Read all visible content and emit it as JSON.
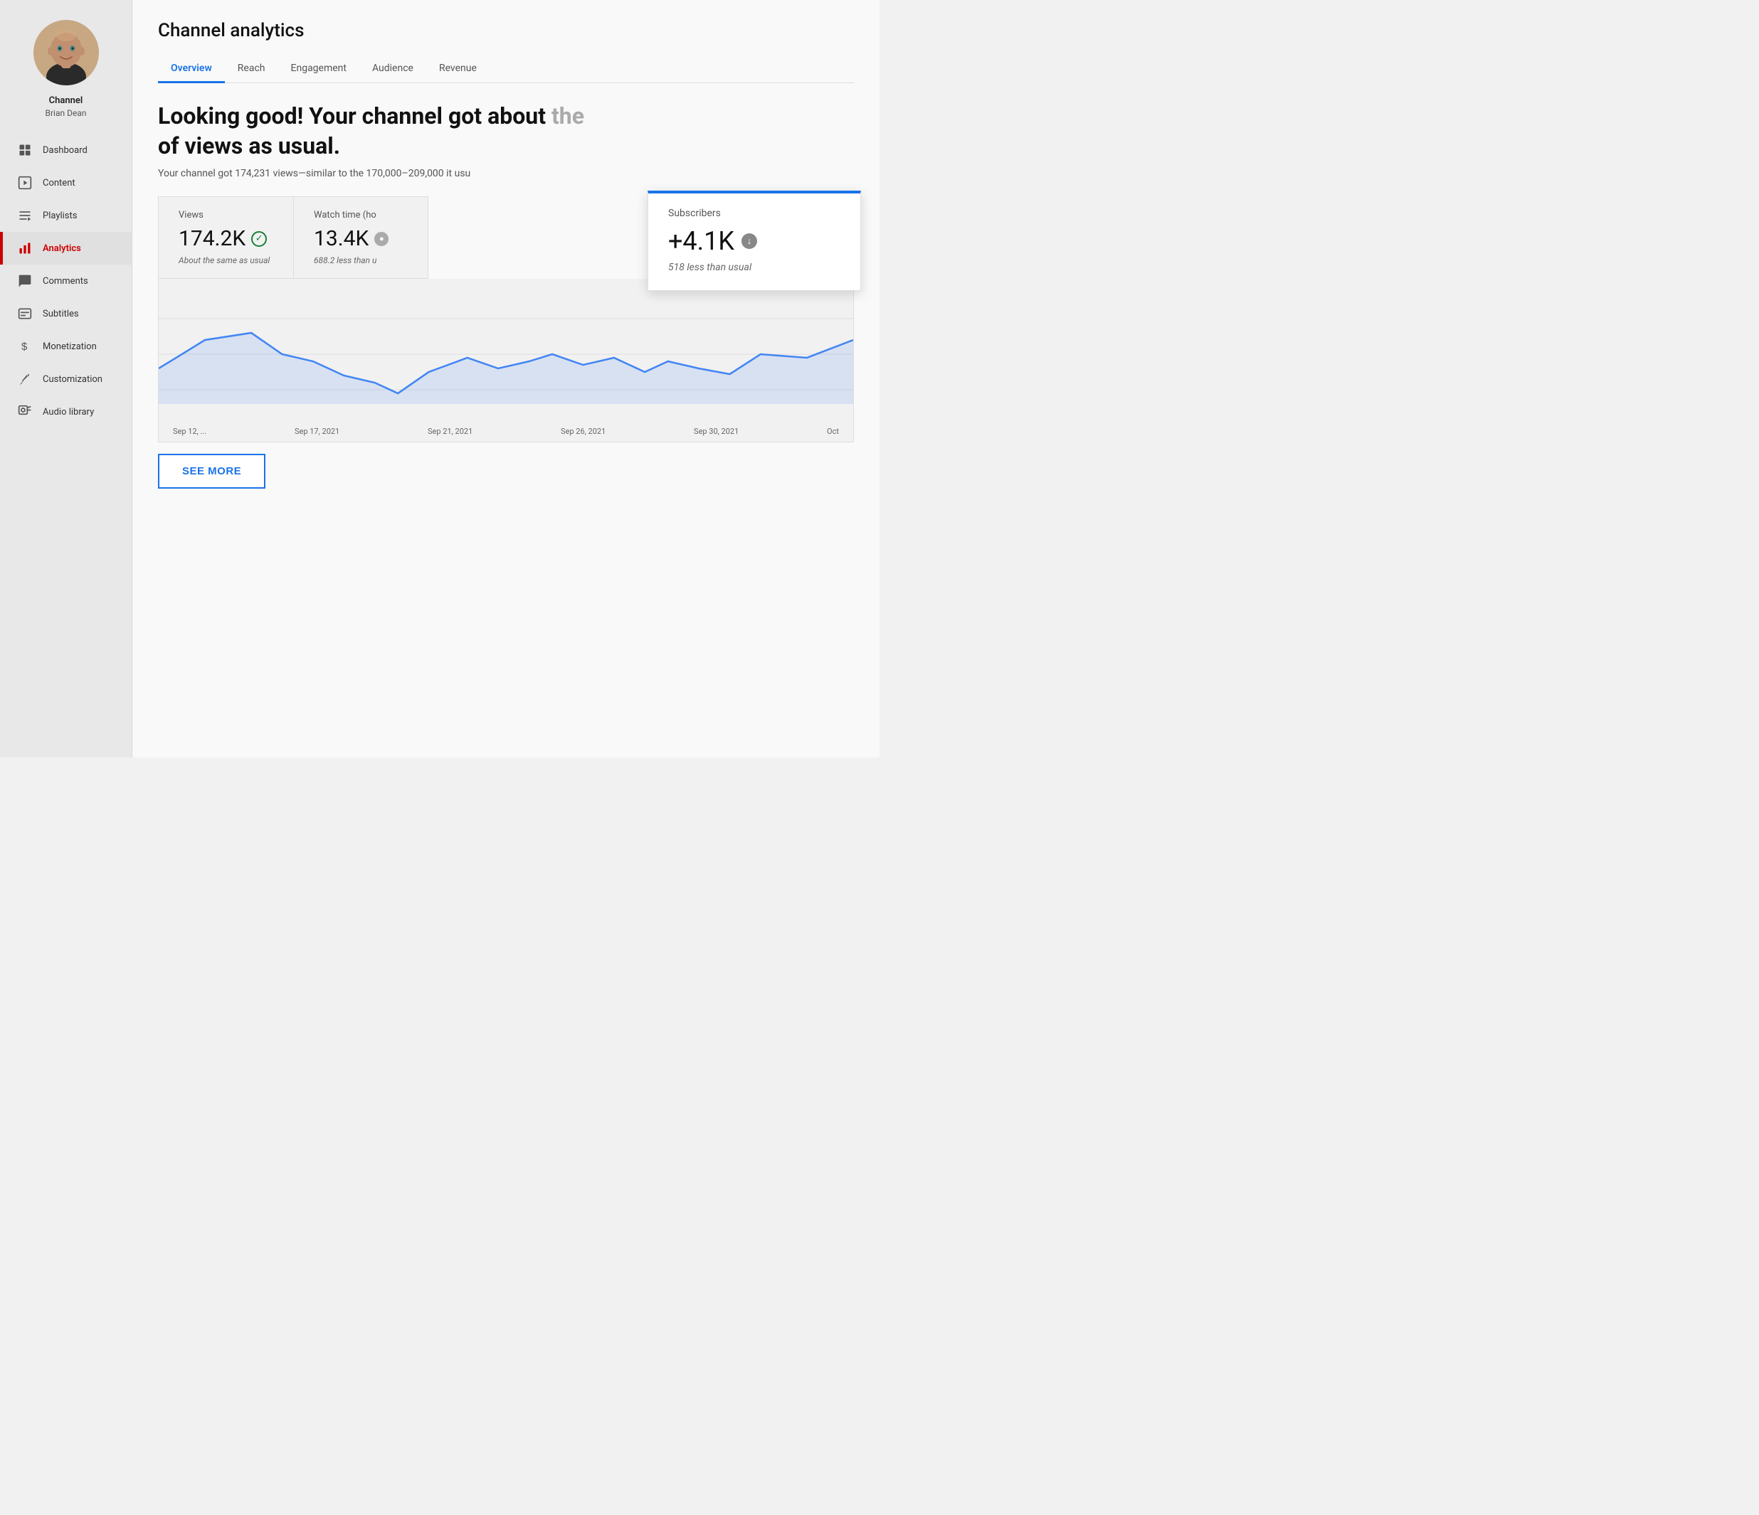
{
  "sidebar": {
    "channel_name": "Channel",
    "channel_user": "Brian Dean",
    "nav_items": [
      {
        "id": "dashboard",
        "label": "Dashboard",
        "icon": "grid",
        "active": false
      },
      {
        "id": "content",
        "label": "Content",
        "icon": "play",
        "active": false
      },
      {
        "id": "playlists",
        "label": "Playlists",
        "icon": "list",
        "active": false
      },
      {
        "id": "analytics",
        "label": "Analytics",
        "icon": "bar-chart",
        "active": true
      },
      {
        "id": "comments",
        "label": "Comments",
        "icon": "comment",
        "active": false
      },
      {
        "id": "subtitles",
        "label": "Subtitles",
        "icon": "subtitles",
        "active": false
      },
      {
        "id": "monetization",
        "label": "Monetization",
        "icon": "dollar",
        "active": false
      },
      {
        "id": "customization",
        "label": "Customization",
        "icon": "brush",
        "active": false
      },
      {
        "id": "audio-library",
        "label": "Audio library",
        "icon": "music",
        "active": false
      }
    ]
  },
  "main": {
    "page_title": "Channel analytics",
    "tabs": [
      {
        "id": "overview",
        "label": "Overview",
        "active": true
      },
      {
        "id": "reach",
        "label": "Reach",
        "active": false
      },
      {
        "id": "engagement",
        "label": "Engagement",
        "active": false
      },
      {
        "id": "audience",
        "label": "Audience",
        "active": false
      },
      {
        "id": "revenue",
        "label": "Revenue",
        "active": false
      }
    ],
    "headline": "Looking good! Your channel got about the",
    "headline2": "of views as usual.",
    "subtext": "Your channel got 174,231 views—similar to the 170,000–209,000 it usu",
    "metrics": [
      {
        "label": "Views",
        "value": "174.2K",
        "sublabel": "About the same as usual",
        "icon": "check-circle"
      },
      {
        "label": "Watch time (ho",
        "value": "13.4K",
        "sublabel": "688.2 less than u",
        "icon": "circle-neutral"
      }
    ],
    "popup": {
      "label": "Subscribers",
      "value": "+4.1K",
      "sublabel": "518 less than usual",
      "icon": "arrow-down"
    },
    "chart": {
      "dates": [
        "Sep 12, ...",
        "Sep 17, 2021",
        "Sep 21, 2021",
        "Sep 26, 2021",
        "Sep 30, 2021",
        "Oct"
      ]
    },
    "see_more_button": "SEE MORE"
  }
}
